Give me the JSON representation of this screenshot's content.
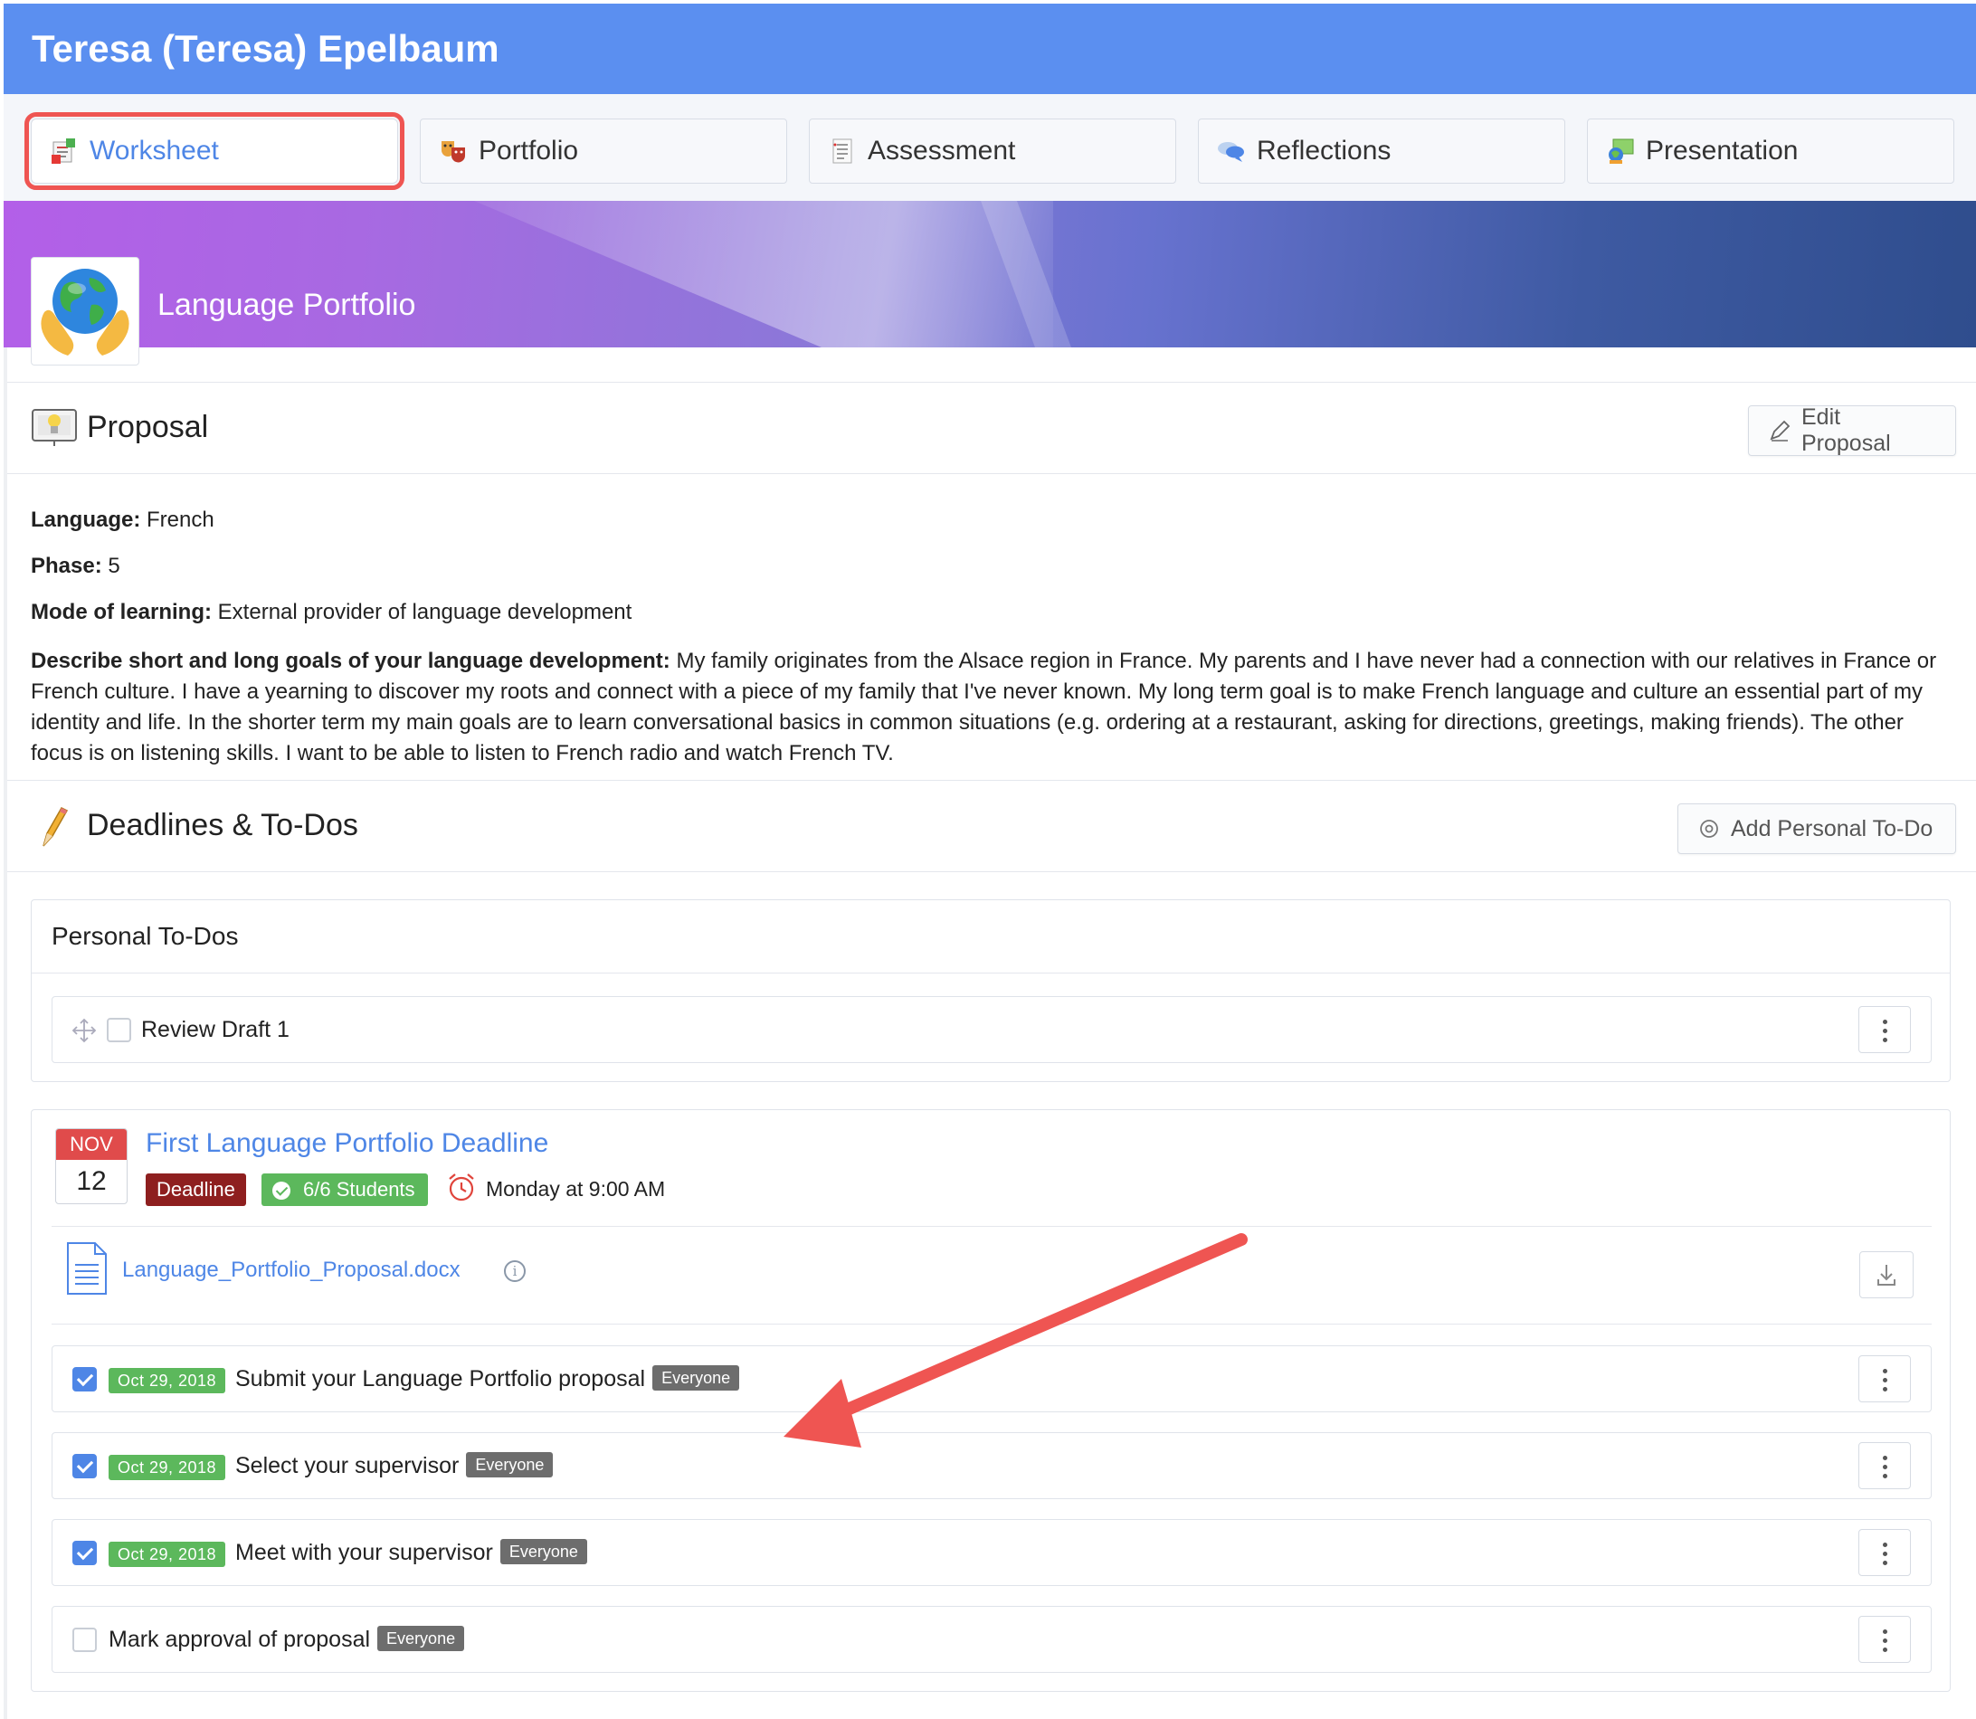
{
  "header": {
    "student_name": "Teresa (Teresa) Epelbaum"
  },
  "tabs": [
    {
      "label": "Worksheet",
      "icon": "worksheet-icon",
      "active": true
    },
    {
      "label": "Portfolio",
      "icon": "theater-masks-icon"
    },
    {
      "label": "Assessment",
      "icon": "checklist-icon"
    },
    {
      "label": "Reflections",
      "icon": "speech-bubbles-icon"
    },
    {
      "label": "Presentation",
      "icon": "presentation-icon"
    }
  ],
  "banner": {
    "title": "Language Portfolio",
    "logo_icon": "globe-in-hands-icon"
  },
  "proposal": {
    "title": "Proposal",
    "edit_button": "Edit Proposal",
    "language_label": "Language:",
    "language_value": "French",
    "phase_label": "Phase:",
    "phase_value": "5",
    "mode_label": "Mode of learning:",
    "mode_value": "External provider of language development",
    "goals_label": "Describe short and long goals of your language development:",
    "goals_value": "My family originates from the Alsace region in France. My parents and I have never had a connection with our relatives in France or French culture. I have a yearning to discover my roots and connect with a piece of my family that I've never known. My long term goal is to make French language and culture an essential part of my identity and life. In the shorter term my main goals are to learn conversational basics in common situations (e.g. ordering at a restaurant, asking for directions, greetings, making friends). The other focus is on listening skills. I want to be able to listen to French radio and watch French TV."
  },
  "deadlines": {
    "title": "Deadlines & To-Dos",
    "add_button": "Add Personal To-Do",
    "personal": {
      "title": "Personal To-Dos",
      "items": [
        {
          "text": "Review Draft 1",
          "checked": false
        }
      ]
    },
    "deadline": {
      "month": "NOV",
      "day": "12",
      "title": "First Language Portfolio Deadline",
      "type_badge": "Deadline",
      "students_badge": "6/6 Students",
      "when": "Monday at 9:00 AM",
      "file": "Language_Portfolio_Proposal.docx",
      "tasks": [
        {
          "date": "Oct 29, 2018",
          "text": "Submit your Language Portfolio proposal",
          "tag": "Everyone",
          "checked": true
        },
        {
          "date": "Oct 29, 2018",
          "text": "Select your supervisor",
          "tag": "Everyone",
          "checked": true
        },
        {
          "date": "Oct 29, 2018",
          "text": "Meet with your supervisor",
          "tag": "Everyone",
          "checked": true
        },
        {
          "date": "",
          "text": "Mark approval of proposal",
          "tag": "Everyone",
          "checked": false
        }
      ]
    }
  },
  "colors": {
    "header": "#5b8ff0",
    "link": "#4e86e6",
    "highlight": "#ef5552",
    "success": "#5cb85c",
    "danger": "#8e1f1f"
  }
}
